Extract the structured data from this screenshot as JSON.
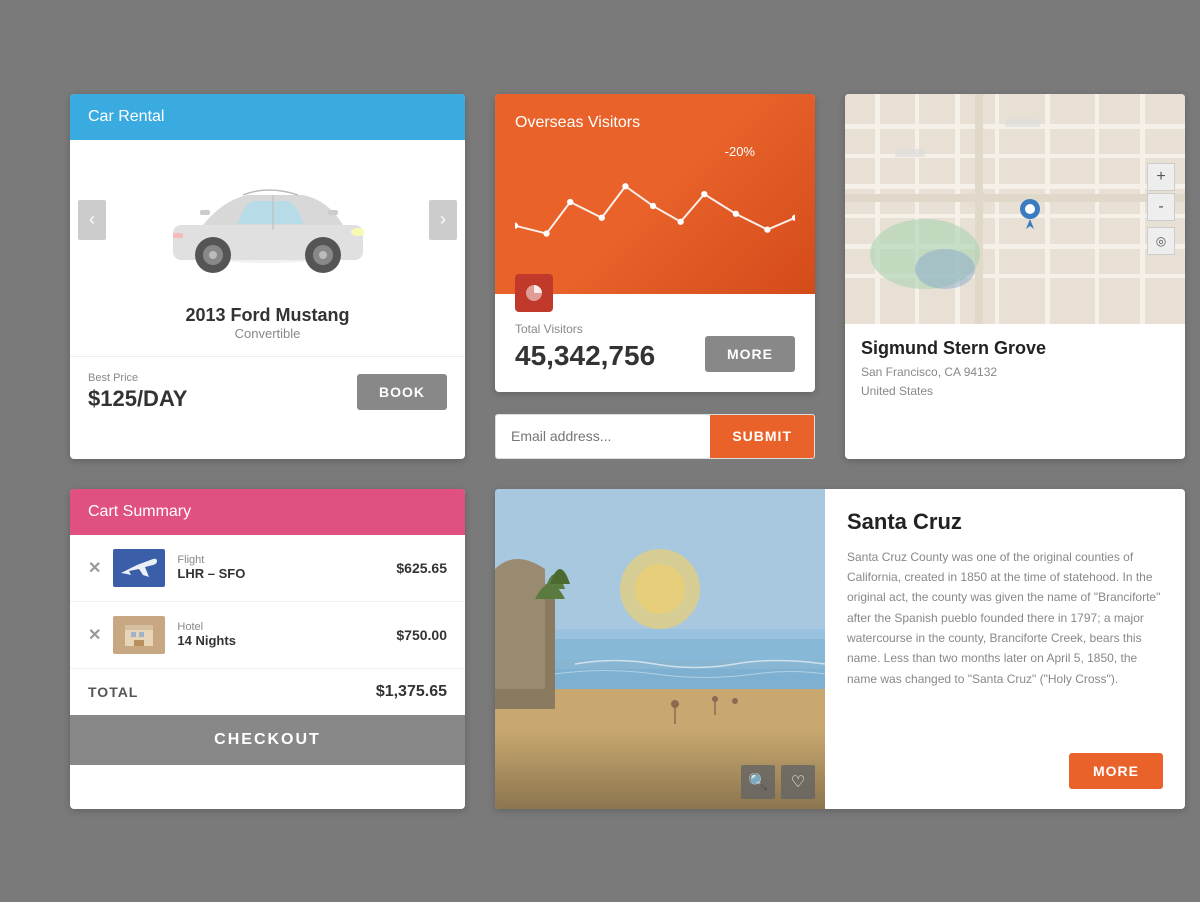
{
  "page": {
    "background": "#7a7a7a"
  },
  "visitors_card": {
    "title": "Overseas Visitors",
    "chart_label": "-20%",
    "total_label": "Total Visitors",
    "total_count": "45,342,756",
    "more_btn": "MORE",
    "icon": "pie-chart-icon",
    "chart_color": "#e8622a"
  },
  "email_form": {
    "placeholder": "Email address...",
    "submit_btn": "SUBMIT"
  },
  "car_rental_card": {
    "header": "Car Rental",
    "header_color": "#3aabe0",
    "car_name": "2013 Ford Mustang",
    "car_type": "Convertible",
    "price_label": "Best Price",
    "price": "$125/DAY",
    "book_btn": "BOOK",
    "prev_icon": "chevron-left-icon",
    "next_icon": "chevron-right-icon"
  },
  "map_card": {
    "place_name": "Sigmund Stern Grove",
    "address_line1": "San Francisco, CA 94132",
    "address_line2": "United States",
    "zoom_plus": "+",
    "zoom_minus": "-",
    "compass": "◎",
    "pin_icon": "map-pin-icon"
  },
  "cart_card": {
    "header": "Cart Summary",
    "header_color": "#e05080",
    "items": [
      {
        "category": "Flight",
        "description": "LHR – SFO",
        "price": "$625.65",
        "thumb_type": "plane"
      },
      {
        "category": "Hotel",
        "description": "14 Nights",
        "price": "$750.00",
        "thumb_type": "hotel"
      }
    ],
    "total_label": "TOTAL",
    "total_price": "$1,375.65",
    "checkout_btn": "CHECKOUT"
  },
  "santa_cruz_card": {
    "title": "Santa Cruz",
    "description": "Santa Cruz County was one of the original counties of California, created in 1850 at the time of statehood. In the original act, the county was given the name of \"Branciforte\" after the Spanish pueblo founded there in 1797; a major watercourse in the county, Branciforte Creek, bears this name. Less than two months later on April 5, 1850, the name was changed to \"Santa Cruz\" (\"Holy Cross\").",
    "more_btn": "MORE",
    "search_icon": "search-icon",
    "heart_icon": "heart-icon"
  }
}
